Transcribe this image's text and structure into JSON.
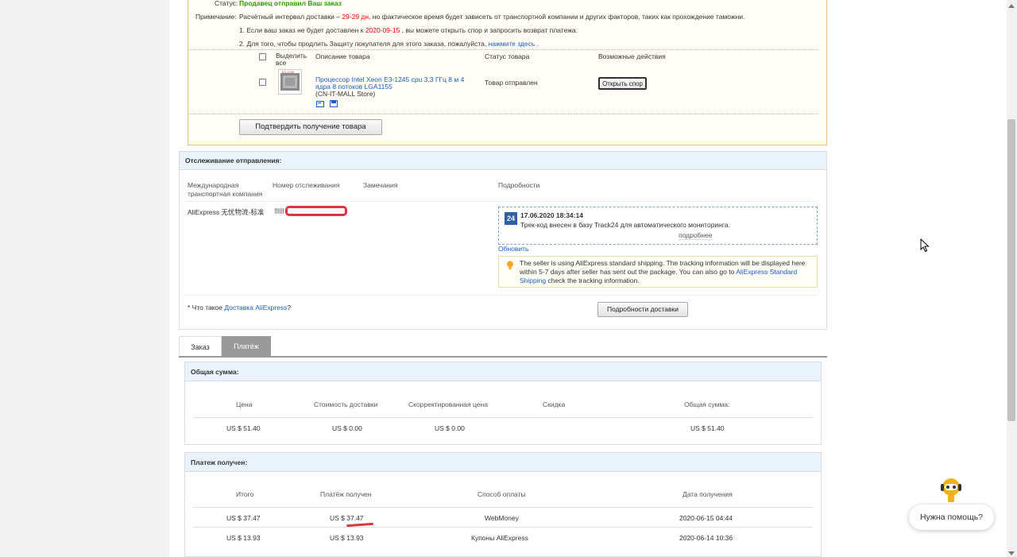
{
  "order": {
    "status_label": "Статус:",
    "status_value": "Продавец отправил Ваш заказ",
    "note_label": "Примечание:",
    "note_text_1": "Расчётный интервал доставки –",
    "note_days": "29-29 дн",
    "note_text_2": ", но фактическое время будет зависеть от транспортной компании и других факторов, таких как прохождение таможни.",
    "item1_a": "1. Если ваш заказ не будет доставлен к",
    "item1_date": "2020-09-15",
    "item1_b": ", вы можете открыть спор и запросить возврат платежа.",
    "item2_a": "2. Для того, чтобы продлить Защиту покупателя для этого заказа, пожалуйста,",
    "item2_link": "нажмите здесь",
    "item2_b": ".",
    "col_select": "Выделить все",
    "col_desc": "Описание товара",
    "col_status": "Статус товара",
    "col_actions": "Возможные действия",
    "product_title": "Процессор Intel Xeon E3-1245 cpu 3,3 ГГц 8 м 4 ядра 8 потоков LGA1155",
    "product_store": "(CN-IT-MALL Store)",
    "product_status": "Товар отправлен",
    "dispute_btn": "Открыть спор",
    "confirm_btn": "Подтвердить получение товара"
  },
  "tracking": {
    "title": "Отслеживание отправления:",
    "col_carrier": "Международная транспортная компания",
    "col_number": "Номер отслеживания",
    "col_remarks": "Замечания",
    "col_details": "Подробности",
    "carrier": "AliExpress 无忧物流-标准",
    "event_badge": "24",
    "event_time": "17.06.2020 18:34:14",
    "event_text": "Трек-код внесен в базу Track24 для автоматического мониторинга.",
    "event_more": "подробнее",
    "refresh": "Обновить",
    "info_text_1": "The seller is using AliExpress standard shipping. The tracking information will be displayed here within 5-7 days after seller has sent out the package. You can also go to",
    "info_link": "AliExpress Standard Shipping",
    "info_text_2": "check the tracking information.",
    "footnote_a": "* Что такое",
    "footnote_link": "Доставка AliExpress",
    "footnote_b": "?",
    "details_btn": "Подробности доставки"
  },
  "tabs": [
    "Заказ",
    "Платёж"
  ],
  "total": {
    "title": "Общая сумма:",
    "headers": [
      "Цена",
      "Стоимость доставки",
      "Скорректированная цена",
      "Скидка",
      "Общая сумма:"
    ],
    "row": [
      "US $ 51.40",
      "US $ 0.00",
      "US $ 0.00",
      "",
      "US $ 51.40"
    ]
  },
  "payment": {
    "title": "Платеж получен:",
    "headers": [
      "Итого",
      "Платёж получен",
      "Способ оплаты",
      "Дата получения"
    ],
    "rows": [
      [
        "US $ 37.47",
        "US $ 37.47",
        "WebMoney",
        "2020-06-15 04:44"
      ],
      [
        "US $ 13.93",
        "US $ 13.93",
        "Купоны AliExpress",
        "2020-06-14 10:36"
      ]
    ]
  },
  "help": "Нужна помощь?",
  "colors": {
    "accent_link": "#1a5ec2",
    "status_green": "#2a9d00",
    "alert_red": "#e00",
    "box_header": "#eaf2fb",
    "active_tab": "#999999",
    "annotation_red": "#d9383c"
  }
}
